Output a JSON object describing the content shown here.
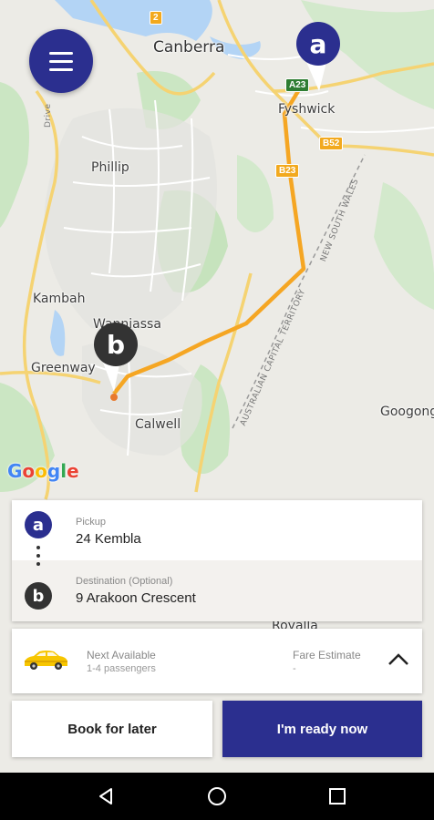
{
  "map": {
    "places": {
      "canberra": "Canberra",
      "fyshwick": "Fyshwick",
      "phillip": "Phillip",
      "kambah": "Kambah",
      "wanniassa": "Wanniassa",
      "greenway": "Greenway",
      "calwell": "Calwell",
      "googong": "Googong",
      "royalla": "Royalla"
    },
    "shields": {
      "a23": "A23",
      "b52": "B52",
      "b23": "B23",
      "two": "2"
    },
    "road_labels": {
      "nsw": "NEW SOUTH WALES",
      "act": "AUSTRALIAN CAPITAL TERRITORY",
      "drive": "Drive"
    },
    "pickup_marker": "a",
    "destination_marker": "b",
    "google_logo": "Google",
    "route_color": "#f5a623"
  },
  "locations": {
    "pickup_label": "Pickup",
    "pickup_value": "24 Kembla",
    "pickup_badge": "a",
    "destination_label": "Destination (Optional)",
    "destination_value": "9 Arakoon Crescent",
    "destination_badge": "b"
  },
  "vehicle": {
    "title": "Next Available",
    "capacity": "1-4 passengers",
    "fare_label": "Fare Estimate",
    "fare_value": "-",
    "icon": "taxi-icon"
  },
  "actions": {
    "book_later": "Book for later",
    "ready_now": "I'm ready now"
  },
  "colors": {
    "brand": "#2b2f8f",
    "destination": "#333333"
  }
}
